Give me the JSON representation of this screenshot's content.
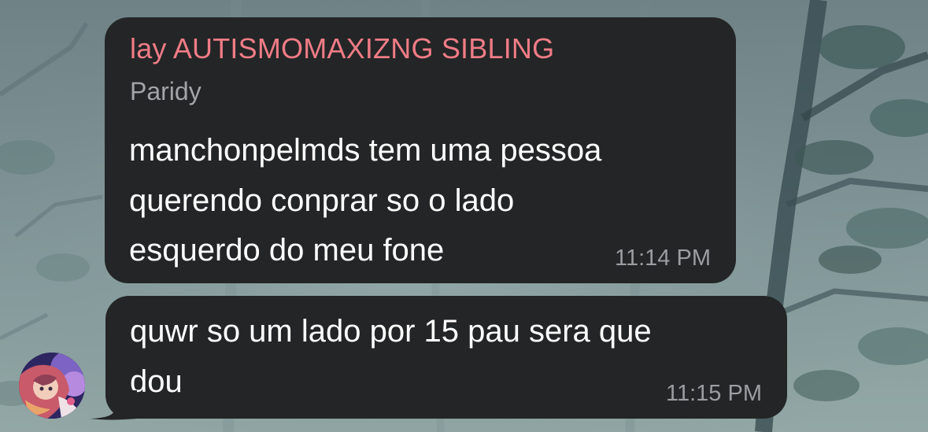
{
  "chat": {
    "sender_name": "lay AUTISMOMAXIZNG SIBLING",
    "sender_subtitle": "Paridy",
    "messages": [
      {
        "text": "manchonpelmds tem uma pessoa\nquerendo conprar so o lado\nesquerdo do meu fone",
        "time": "11:14 PM"
      },
      {
        "text": "quwr so um lado por 15 pau sera que\ndou",
        "time": "11:15 PM"
      }
    ]
  },
  "colors": {
    "bubble_background": "#242526",
    "sender_name": "#f07c86",
    "subtitle": "#a3a4a8",
    "message_text": "#ffffff",
    "timestamp": "#9c9da1"
  },
  "icons": {
    "avatar": "anime-character-avatar"
  }
}
